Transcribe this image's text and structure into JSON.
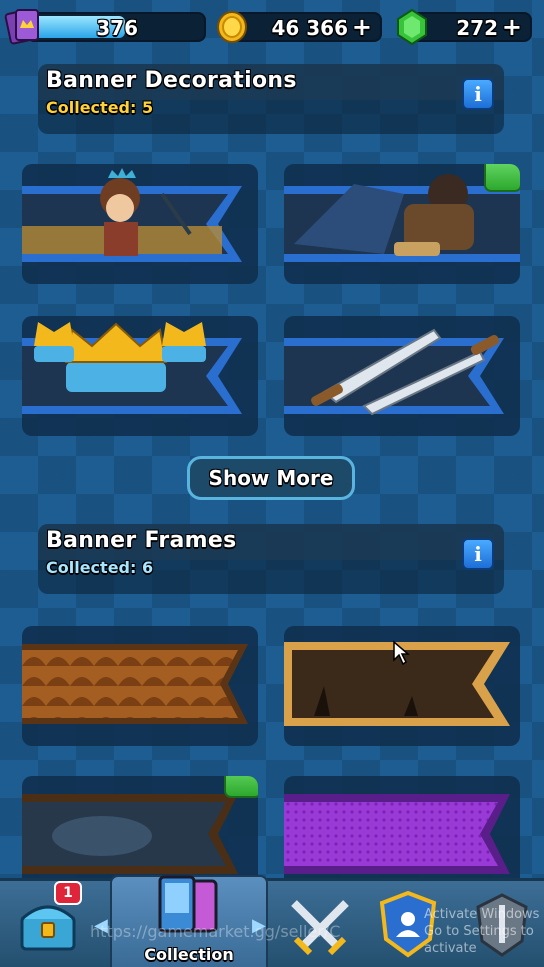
{
  "resources": {
    "trophies": "376",
    "gold": "46 366",
    "gems": "272",
    "plus": "+"
  },
  "decorations": {
    "title": "Banner Decorations",
    "collected": "Collected: 5",
    "info": "i"
  },
  "show_more": "Show More",
  "frames": {
    "title": "Banner Frames",
    "collected": "Collected: 6",
    "info": "i"
  },
  "nav": {
    "chest_badge": "1",
    "collection_label": "Collection"
  },
  "overlays": {
    "url_watermark": "https://gamemarket.gg/seller/C",
    "windows_line1": "Activate Windows",
    "windows_line2": "Go to Settings to activate"
  },
  "colors": {
    "accent_yellow": "#ffd23a",
    "banner_blue": "#2a6ed0",
    "check_green": "#3dbf3d"
  }
}
